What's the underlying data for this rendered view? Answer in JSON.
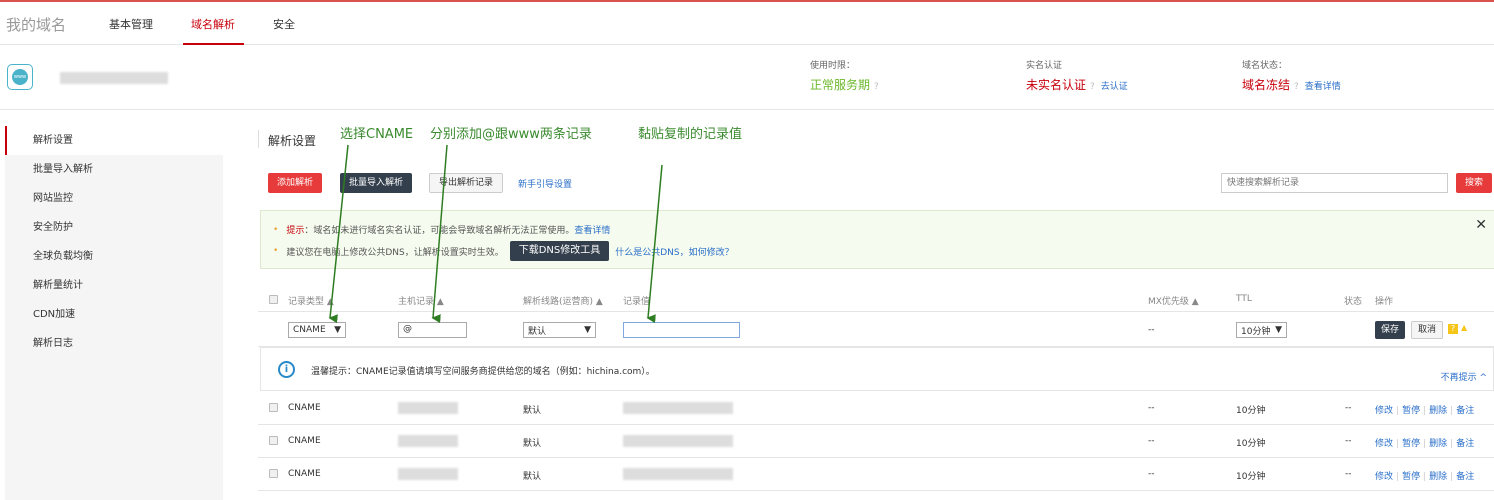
{
  "nav": {
    "brand": "我的域名",
    "tabs": [
      {
        "label": "基本管理"
      },
      {
        "label": "域名解析",
        "active": true
      },
      {
        "label": "安全"
      }
    ]
  },
  "header": {
    "icon": "www-globe-icon",
    "period": {
      "label": "使用时限：",
      "value": "正常服务期"
    },
    "realname": {
      "label": "实名认证",
      "value": "未实名认证",
      "link": "去认证"
    },
    "status": {
      "label": "域名状态：",
      "value": "域名冻结",
      "link": "查看详情"
    },
    "colors": {
      "green": "#6cb82a",
      "red": "#c7000b",
      "link": "#2a6fc9"
    }
  },
  "sidebar": {
    "items": [
      {
        "label": "解析设置",
        "active": true
      },
      {
        "label": "批量导入解析"
      },
      {
        "label": "网站监控"
      },
      {
        "label": "安全防护"
      },
      {
        "label": "全球负载均衡"
      },
      {
        "label": "解析量统计"
      },
      {
        "label": "CDN加速"
      },
      {
        "label": "解析日志"
      }
    ]
  },
  "annotations": [
    "选择CNAME",
    "分别添加@跟www两条记录",
    "黏贴复制的记录值"
  ],
  "main": {
    "title": "解析设置",
    "toolbar": {
      "add": "添加解析",
      "import": "批量导入解析",
      "export": "导出解析记录",
      "guide": "新手引导设置",
      "search_placeholder": "快速搜索解析记录",
      "search": "搜索"
    },
    "notice": {
      "line1_prefix": "提示",
      "line1": "：域名如未进行域名实名认证，可能会导致域名解析无法正常使用。",
      "line1_link": "查看详情",
      "line2": "建议您在电脑上修改公共DNS，让解析设置实时生效。",
      "line2_button": "下载DNS修改工具",
      "line2_link": "什么是公共DNS，如何修改？"
    },
    "columns": [
      "记录类型",
      "主机记录",
      "解析线路(运营商)",
      "记录值",
      "MX优先级",
      "TTL",
      "状态",
      "操作"
    ],
    "edit": {
      "type": "CNAME",
      "host": "@",
      "line": "默认",
      "value": "",
      "mx": "--",
      "ttl": "10分钟",
      "save": "保存",
      "cancel": "取消"
    },
    "tip": {
      "text": "温馨提示：CNAME记录值请填写空间服务商提供给您的域名（例如：hichina.com）。",
      "dismiss": "不再提示"
    },
    "rows": [
      {
        "type": "CNAME",
        "line": "默认",
        "mx": "--",
        "ttl": "10分钟",
        "status": "--"
      },
      {
        "type": "CNAME",
        "line": "默认",
        "mx": "--",
        "ttl": "10分钟",
        "status": "--"
      },
      {
        "type": "CNAME",
        "line": "默认",
        "mx": "--",
        "ttl": "10分钟",
        "status": "--"
      }
    ],
    "row_actions": [
      "修改",
      "暂停",
      "删除",
      "备注"
    ]
  }
}
